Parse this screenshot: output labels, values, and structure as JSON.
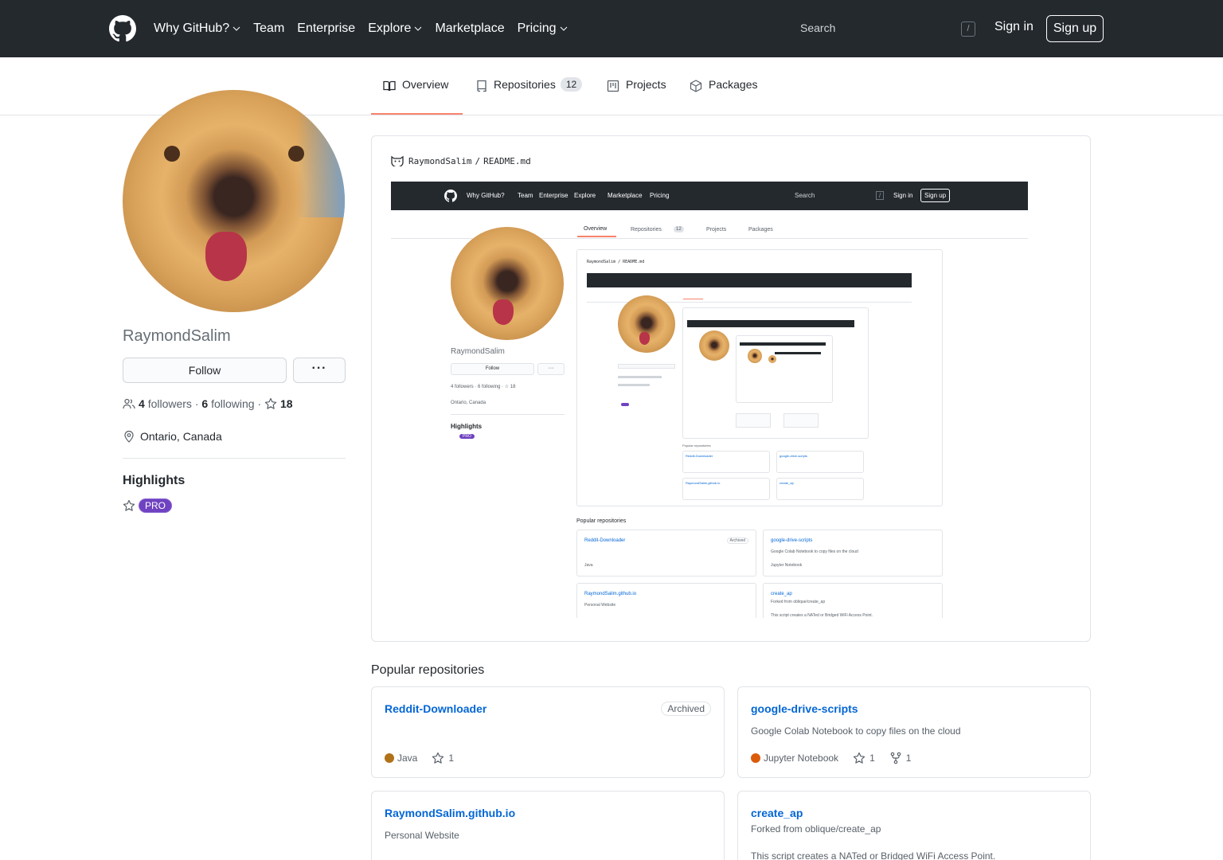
{
  "header": {
    "nav": [
      {
        "label": "Why GitHub?",
        "has_dropdown": true
      },
      {
        "label": "Team",
        "has_dropdown": false
      },
      {
        "label": "Enterprise",
        "has_dropdown": false
      },
      {
        "label": "Explore",
        "has_dropdown": true
      },
      {
        "label": "Marketplace",
        "has_dropdown": false
      },
      {
        "label": "Pricing",
        "has_dropdown": true
      }
    ],
    "search_placeholder": "Search",
    "search_shortcut": "/",
    "sign_in": "Sign in",
    "sign_up": "Sign up"
  },
  "tabs": [
    {
      "label": "Overview",
      "icon": "book-icon",
      "active": true
    },
    {
      "label": "Repositories",
      "icon": "repo-icon",
      "count": "12"
    },
    {
      "label": "Projects",
      "icon": "project-icon"
    },
    {
      "label": "Packages",
      "icon": "package-icon"
    }
  ],
  "profile": {
    "username": "RaymondSalim",
    "follow_label": "Follow",
    "more_label": "···",
    "followers_count": "4",
    "followers_label": "followers",
    "following_count": "6",
    "following_label": "following",
    "stars_count": "18",
    "location": "Ontario, Canada",
    "highlights_title": "Highlights",
    "pro_label": "PRO"
  },
  "readme": {
    "owner": "RaymondSalim",
    "separator": "/",
    "file": "README.md"
  },
  "mini": {
    "nav": [
      "Why GitHub?",
      "Team",
      "Enterprise",
      "Explore",
      "Marketplace",
      "Pricing"
    ],
    "search": "Search",
    "slash": "/",
    "sign_in": "Sign in",
    "sign_up": "Sign up",
    "tabs": [
      "Overview",
      "Repositories",
      "12",
      "Projects",
      "Packages"
    ],
    "username": "RaymondSalim",
    "follow": "Follow",
    "more": "···",
    "stats": "4 followers · 6 following · ☆ 18",
    "location": "Ontario, Canada",
    "highlights": "Highlights",
    "pro": "PRO",
    "readme_path": "RaymondSalim / README.md",
    "popular": "Popular repositories",
    "repos": [
      {
        "name": "Reddit-Downloader",
        "badge": "Archived",
        "lang": "Java",
        "stars": "1"
      },
      {
        "name": "google-drive-scripts",
        "desc": "Google Colab Notebook to copy files on the cloud",
        "lang": "Jupyter Notebook",
        "stars": "1",
        "forks": "1"
      },
      {
        "name": "RaymondSalim.github.io",
        "desc": "Personal Website"
      },
      {
        "name": "create_ap",
        "forked": "Forked from oblique/create_ap",
        "desc": "This script creates a NATed or Bridged WiFi Access Point."
      }
    ]
  },
  "popular": {
    "title": "Popular repositories",
    "repos": [
      {
        "name": "Reddit-Downloader",
        "badge": "Archived",
        "language": "Java",
        "lang_color": "#b07219",
        "stars": "1"
      },
      {
        "name": "google-drive-scripts",
        "description": "Google Colab Notebook to copy files on the cloud",
        "language": "Jupyter Notebook",
        "lang_color": "#DA5B0B",
        "stars": "1",
        "forks": "1"
      },
      {
        "name": "RaymondSalim.github.io",
        "description": "Personal Website"
      },
      {
        "name": "create_ap",
        "description": "Forked from oblique/create_ap",
        "extra": "This script creates a NATed or Bridged WiFi Access Point."
      }
    ]
  },
  "colors": {
    "header_bg": "#24292e",
    "accent_tab": "#f9826c",
    "link": "#0366d6",
    "pro": "#6f42c1"
  }
}
